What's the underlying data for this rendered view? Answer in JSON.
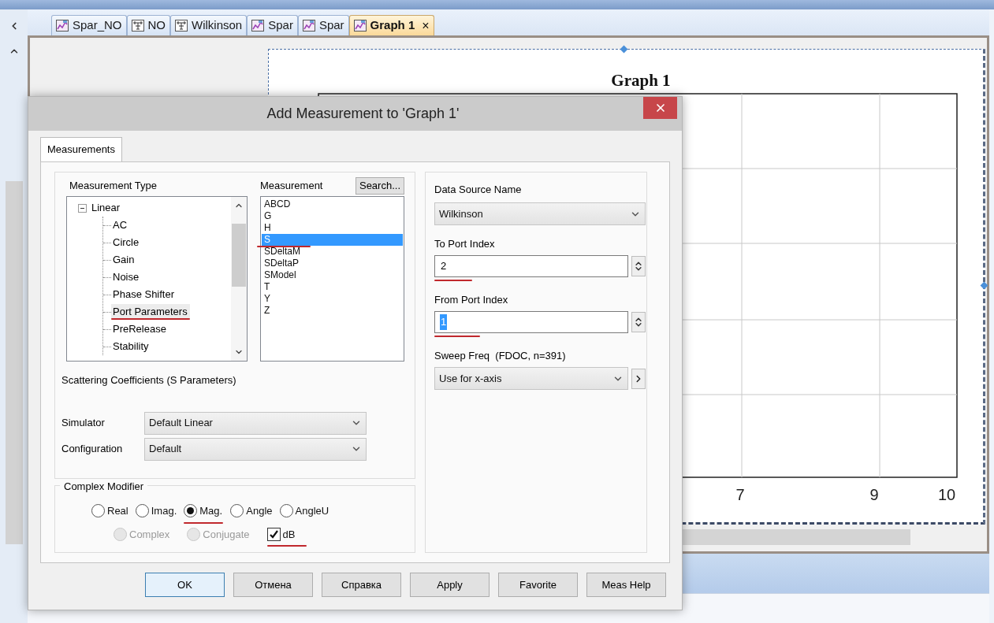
{
  "document_tabs": [
    {
      "label": "Spar_NO",
      "kind": "graph",
      "selected": false
    },
    {
      "label": "NO",
      "kind": "schematic",
      "selected": false
    },
    {
      "label": "Wilkinson",
      "kind": "schematic",
      "selected": false
    },
    {
      "label": "Spar",
      "kind": "graph",
      "selected": false
    },
    {
      "label": "Spar",
      "kind": "graph",
      "selected": false
    },
    {
      "label": "Graph 1",
      "kind": "graph",
      "selected": true,
      "close": "×"
    }
  ],
  "graph": {
    "title": "Graph 1",
    "x_tick_labels": [
      "7",
      "9",
      "10"
    ]
  },
  "dialog": {
    "title": "Add Measurement to 'Graph 1'",
    "tabs": [
      {
        "label": "Measurements",
        "selected": true
      }
    ],
    "measurement_type": {
      "label": "Measurement Type",
      "tree": [
        {
          "label": "Linear",
          "expanded": true,
          "selected": false,
          "children": [
            {
              "label": "AC",
              "selected": false,
              "annotated": false
            },
            {
              "label": "Circle",
              "selected": false,
              "annotated": false
            },
            {
              "label": "Gain",
              "selected": false,
              "annotated": false
            },
            {
              "label": "Noise",
              "selected": false,
              "annotated": false
            },
            {
              "label": "Phase Shifter",
              "selected": false,
              "annotated": false
            },
            {
              "label": "Port Parameters",
              "selected": true,
              "annotated": true
            },
            {
              "label": "PreRelease",
              "selected": false,
              "annotated": false
            },
            {
              "label": "Stability",
              "selected": false,
              "annotated": false
            }
          ]
        }
      ]
    },
    "measurement": {
      "label": "Measurement",
      "search_button": "Search...",
      "items": [
        {
          "label": "ABCD",
          "selected": false,
          "annotated": false
        },
        {
          "label": "G",
          "selected": false,
          "annotated": false
        },
        {
          "label": "H",
          "selected": false,
          "annotated": false
        },
        {
          "label": "S",
          "selected": true,
          "annotated": true
        },
        {
          "label": "SDeltaM",
          "selected": false,
          "annotated": false
        },
        {
          "label": "SDeltaP",
          "selected": false,
          "annotated": false
        },
        {
          "label": "SModel",
          "selected": false,
          "annotated": false
        },
        {
          "label": "T",
          "selected": false,
          "annotated": false
        },
        {
          "label": "Y",
          "selected": false,
          "annotated": false
        },
        {
          "label": "Z",
          "selected": false,
          "annotated": false
        }
      ]
    },
    "description": "Scattering Coefficients (S Parameters)",
    "simulator": {
      "label": "Simulator",
      "value": "Default Linear"
    },
    "configuration": {
      "label": "Configuration",
      "value": "Default"
    },
    "complex_modifier": {
      "title": "Complex Modifier",
      "options": [
        {
          "label": "Real",
          "kind": "radio",
          "selected": false,
          "disabled": false,
          "annotated": false
        },
        {
          "label": "Imag.",
          "kind": "radio",
          "selected": false,
          "disabled": false,
          "annotated": false
        },
        {
          "label": "Mag.",
          "kind": "radio",
          "selected": true,
          "disabled": false,
          "annotated": true
        },
        {
          "label": "Angle",
          "kind": "radio",
          "selected": false,
          "disabled": false,
          "annotated": false
        },
        {
          "label": "AngleU",
          "kind": "radio",
          "selected": false,
          "disabled": false,
          "annotated": false
        }
      ],
      "extras": [
        {
          "label": "Complex",
          "kind": "radio",
          "selected": false,
          "disabled": true,
          "annotated": false
        },
        {
          "label": "Conjugate",
          "kind": "radio",
          "selected": false,
          "disabled": true,
          "annotated": false
        },
        {
          "label": "dB",
          "kind": "checkbox",
          "checked": true,
          "disabled": false,
          "annotated": true
        }
      ]
    },
    "data_source": {
      "label": "Data Source Name",
      "value": "Wilkinson"
    },
    "to_port": {
      "label": "To Port Index",
      "value": "2",
      "value_selected": false,
      "annotated": true
    },
    "from_port": {
      "label": "From Port Index",
      "value": "1",
      "value_selected": true,
      "annotated": true
    },
    "sweep": {
      "label": "Sweep Freq  (FDOC, n=391)",
      "value": "Use for x-axis"
    },
    "buttons": [
      {
        "label": "OK",
        "default": true
      },
      {
        "label": "Отмена",
        "default": false
      },
      {
        "label": "Справка",
        "default": false
      },
      {
        "label": "Apply",
        "default": false
      },
      {
        "label": "Favorite",
        "default": false
      },
      {
        "label": "Meas Help",
        "default": false
      }
    ]
  }
}
